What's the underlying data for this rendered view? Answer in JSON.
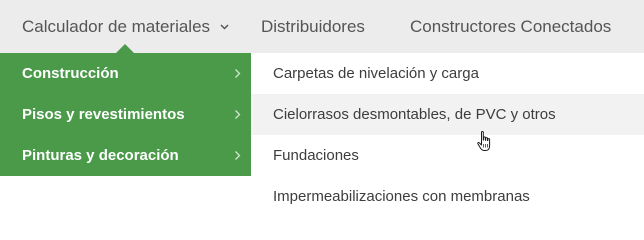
{
  "navbar": {
    "items": [
      {
        "label": "Calculador de materiales",
        "has_dropdown": true
      },
      {
        "label": "Distribuidores"
      },
      {
        "label": "Constructores Conectados"
      }
    ]
  },
  "submenu_left": {
    "items": [
      {
        "label": "Construcción"
      },
      {
        "label": "Pisos y revestimientos"
      },
      {
        "label": "Pinturas y decoración"
      }
    ]
  },
  "submenu_right": {
    "items": [
      {
        "label": "Carpetas de nivelación y carga"
      },
      {
        "label": "Cielorrasos desmontables, de PVC y otros"
      },
      {
        "label": "Fundaciones"
      },
      {
        "label": "Impermeabilizaciones con membranas"
      }
    ],
    "hovered_index": 1
  },
  "colors": {
    "menu_green": "#4a9a4a",
    "navbar_bg": "#ececec",
    "hover_bg": "#f2f2f2"
  },
  "icons": [
    "chevron-down-icon",
    "chevron-right-icon",
    "hand-pointer-cursor-icon"
  ]
}
